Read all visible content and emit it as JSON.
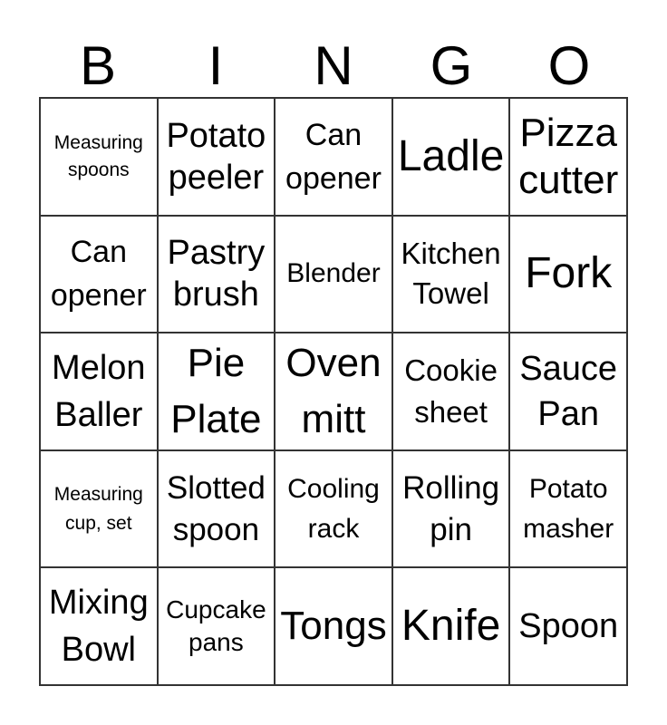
{
  "header": [
    "B",
    "I",
    "N",
    "G",
    "O"
  ],
  "cells": [
    "Measuring spoons",
    "Potato peeler",
    "Can opener",
    "Ladle",
    "Pizza cutter",
    "Can opener",
    "Pastry brush",
    "Blender",
    "Kitchen Towel",
    "Fork",
    "Melon Baller",
    "Pie Plate",
    "Oven mitt",
    "Cookie sheet",
    "Sauce Pan",
    "Measuring cup, set",
    "Slotted spoon",
    "Cooling rack",
    "Rolling pin",
    "Potato masher",
    "Mixing Bowl",
    "Cupcake pans",
    "Tongs",
    "Knife",
    "Spoon"
  ]
}
